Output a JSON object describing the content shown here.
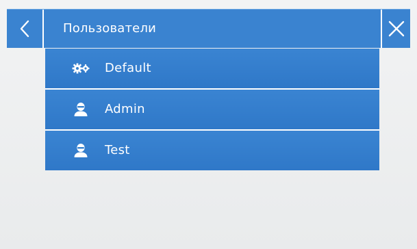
{
  "header": {
    "title": "Пользователи",
    "back_icon": "chevron-left-icon",
    "close_icon": "close-icon"
  },
  "users": [
    {
      "label": "Default",
      "icon": "gears-icon"
    },
    {
      "label": "Admin",
      "icon": "user-icon"
    },
    {
      "label": "Test",
      "icon": "user-icon"
    }
  ],
  "colors": {
    "accent": "#3a83d0",
    "background": "#eef0f1",
    "text": "#ffffff"
  }
}
